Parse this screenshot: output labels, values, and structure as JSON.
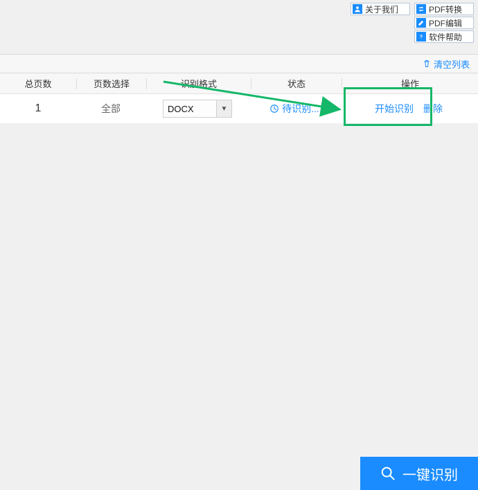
{
  "top_menu_left": {
    "about": "关于我们"
  },
  "top_menu_right": {
    "pdf_convert": "PDF转换",
    "pdf_edit": "PDF编辑",
    "help": "软件帮助"
  },
  "clear_list": "清空列表",
  "columns": {
    "total_pages": "总页数",
    "page_select": "页数选择",
    "format": "识别格式",
    "status": "状态",
    "action": "操作"
  },
  "row": {
    "total_pages": "1",
    "page_select": "全部",
    "format": "DOCX",
    "status": "待识别...",
    "start": "开始识别",
    "delete": "删除"
  },
  "big_button": "一键识别"
}
